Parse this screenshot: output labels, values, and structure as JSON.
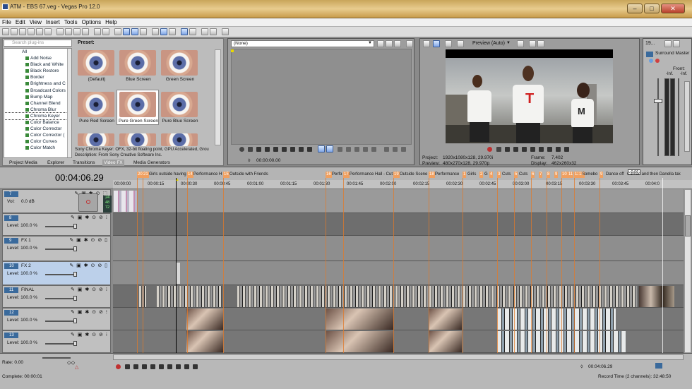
{
  "window": {
    "title": "ATM - EBS 67.veg - Vegas Pro 12.0",
    "minimize": "–",
    "maximize": "□",
    "close": "✕"
  },
  "menu": [
    "File",
    "Edit",
    "View",
    "Insert",
    "Tools",
    "Options",
    "Help"
  ],
  "explorer": {
    "search_placeholder": "Search plug-ins",
    "tree": [
      "All",
      "Add Noise",
      "Black and White",
      "Black Restore",
      "Border",
      "Brightness and C",
      "Broadcast Colors",
      "Bump Map",
      "Channel Blend",
      "Chroma Blur",
      "Chroma Keyer",
      "Color Balance",
      "Color Corrector",
      "Color Corrector (",
      "Color Curves",
      "Color Match"
    ],
    "selected": "Chroma Keyer"
  },
  "presets": {
    "label": "Preset:",
    "items": [
      "(Default)",
      "Blue Screen",
      "Green Screen",
      "Pure Red Screen",
      "Pure Green Screen",
      "Pure Blue Screen"
    ],
    "selected": "Pure Green Screen",
    "description": "Sony Chroma Keyer: OFX, 32-bit floating point, GPU Accelerated, Grou",
    "description2": "Description: From Sony Creative Software Inc."
  },
  "tabs": [
    "Project Media",
    "Explorer",
    "Transitions",
    "Video FX",
    "Media Generators"
  ],
  "active_tab": "Video FX",
  "trimmer": {
    "combo": "(None)",
    "time": "00:00:00.00"
  },
  "preview": {
    "mode": "Preview (Auto)",
    "project_label": "Project:",
    "project": "1920x1080x128, 29.970i",
    "preview_label": "Preview:",
    "preview_val": "480x270x128, 29.970p",
    "frame_label": "Frame:",
    "frame": "7,402",
    "display_label": "Display:",
    "display": "462x260x32"
  },
  "mixer": {
    "num": "19...",
    "title": "Surround Master",
    "front": "Front:",
    "inf1": "-Inf.",
    "inf2": "-Inf."
  },
  "timeline": {
    "time": "00:04:06.29",
    "markers": [
      {
        "n": "20",
        "t": ""
      },
      {
        "n": "21",
        "t": "Girls outside having"
      },
      {
        "n": "14",
        "t": "Performance H"
      },
      {
        "n": "15",
        "t": "Outside with Friends"
      },
      {
        "n": "16",
        "t": "Perfo"
      },
      {
        "n": "17",
        "t": "Performance Hall - Cut"
      },
      {
        "n": "19",
        "t": "Outside Scene"
      },
      {
        "n": "18",
        "t": "Performance"
      },
      {
        "n": "1",
        "t": "Girls"
      },
      {
        "n": "2",
        "t": "G"
      },
      {
        "n": "4",
        "t": ""
      },
      {
        "n": "3",
        "t": "Cuts"
      },
      {
        "n": "5",
        "t": "Cuts"
      },
      {
        "n": "6",
        "t": ""
      },
      {
        "n": "7",
        "t": ""
      },
      {
        "n": "8",
        "t": ""
      },
      {
        "n": "9",
        "t": ""
      },
      {
        "n": "10",
        "t": ""
      },
      {
        "n": "11",
        "t": ""
      },
      {
        "n": "12",
        "t": ""
      },
      {
        "n": "13",
        "t": "Somebo"
      },
      {
        "n": "9",
        "t": "Dance off"
      },
      {
        "n": "",
        "t": "Camac and then Danella tak"
      }
    ],
    "ruler": [
      "00:00:00",
      "00:00:15",
      "00:00:30",
      "00:00:45",
      "00:01:00",
      "00:01:15",
      "00:01:30",
      "00:01:45",
      "00:02:00",
      "00:02:15",
      "00:02:30",
      "00:02:45",
      "00:03:00",
      "00:03:15",
      "00:03:30",
      "00:03:45",
      "00:04:0"
    ],
    "flag": "-0:06"
  },
  "tracks": [
    {
      "num": "7",
      "name": "",
      "level": "Vol:",
      "val": "0.0 dB"
    },
    {
      "num": "8",
      "name": "",
      "level": "Level:",
      "val": "100.0 %"
    },
    {
      "num": "9",
      "name": "FX 1",
      "level": "Level:",
      "val": "100.0 %"
    },
    {
      "num": "10",
      "name": "FX 2",
      "level": "Level:",
      "val": "100.0 %"
    },
    {
      "num": "11",
      "name": "FINAL",
      "level": "Level:",
      "val": "100.0 %"
    },
    {
      "num": "12",
      "name": "",
      "level": "Level:",
      "val": "100.0 %"
    },
    {
      "num": "13",
      "name": "",
      "level": "Level:",
      "val": "100.0 %"
    }
  ],
  "bottom": {
    "rate": "Rate: 0.00",
    "complete": "Complete: 00:00:01",
    "time": "00:04:06.29",
    "record": "Record Time (2 channels): 32:48:50"
  },
  "meter_ticks": [
    "24",
    "48",
    "72"
  ]
}
